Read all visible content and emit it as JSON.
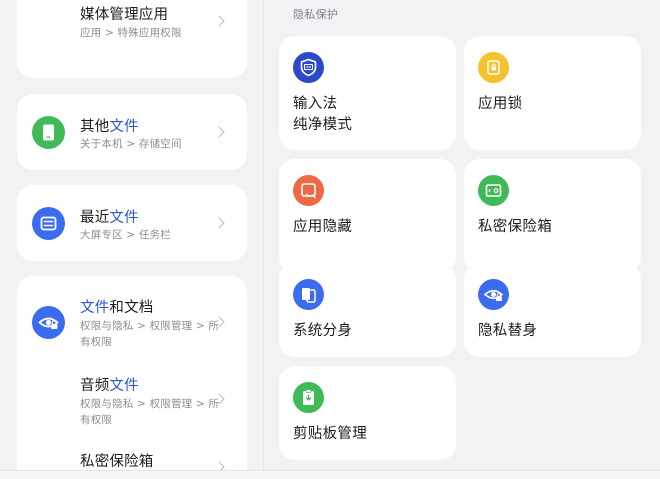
{
  "left_list": {
    "card1": {
      "media": {
        "title": "媒体管理应用",
        "sub": "应用 > 特殊应用权限"
      }
    },
    "card2": {
      "other_files": {
        "title_prefix": "其他",
        "title_accent": "文件",
        "sub": "关于本机 > 存储空间"
      }
    },
    "card3": {
      "recent_files": {
        "title_prefix": "最近",
        "title_accent": "文件",
        "sub": "大屏专区 > 任务栏"
      }
    },
    "card4": {
      "files_docs": {
        "title_accent": "文件",
        "title_suffix": "和文档",
        "sub": "权限与隐私 > 权限管理 > 所有权限"
      },
      "audio_files": {
        "title_prefix": "音频",
        "title_accent": "文件",
        "sub": "权限与隐私 > 权限管理 > 所有权限"
      },
      "private_safe": {
        "title": "私密保险箱"
      }
    }
  },
  "privacy": {
    "section_label": "隐私保护",
    "tiles": [
      {
        "label": "输入法\n纯净模式",
        "icon": "keyboard-shield-icon",
        "color": "#2b49c9"
      },
      {
        "label": "应用锁",
        "icon": "app-lock-icon",
        "color": "#f3c22d"
      },
      {
        "label": "应用隐藏",
        "icon": "hide-app-icon",
        "color": "#ee6a45"
      },
      {
        "label": "私密保险箱",
        "icon": "safe-box-icon",
        "color": "#3fba56"
      },
      {
        "label": "系统分身",
        "icon": "system-clone-icon",
        "color": "#3b6cf0"
      },
      {
        "label": "隐私替身",
        "icon": "privacy-double-icon",
        "color": "#3b6cf0"
      },
      {
        "label": "剪贴板管理",
        "icon": "clipboard-icon",
        "color": "#3fba56"
      }
    ]
  },
  "colors": {
    "accent_text": "#2b55d9",
    "green": "#3fba56",
    "blue": "#3b6cf0",
    "navy": "#2b49c9",
    "yellow": "#f3c22d",
    "orange": "#ee6a45"
  }
}
